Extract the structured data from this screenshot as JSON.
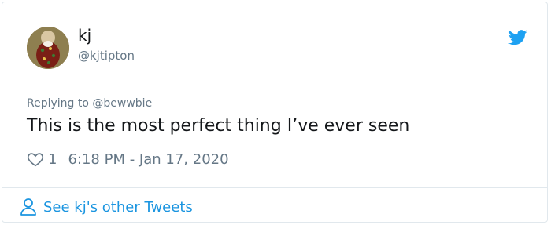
{
  "author": {
    "name": "kj",
    "handle": "@kjtipton"
  },
  "reply": {
    "prefix": "Replying to ",
    "mention": "@bewwbie"
  },
  "tweet": {
    "text": "This is the most perfect thing I’ve ever seen",
    "like_count": "1",
    "timestamp": "6:18 PM - Jan 17, 2020"
  },
  "footer": {
    "link_label": "See kj's other Tweets"
  },
  "icons": {
    "brand": "twitter-bird-icon",
    "like": "heart-outline-icon",
    "profile": "person-outline-icon"
  },
  "colors": {
    "brand_blue": "#1da1f2",
    "link_blue": "#1b95e0",
    "text_primary": "#14171a",
    "text_secondary": "#657786",
    "border": "#e1e8ed"
  }
}
